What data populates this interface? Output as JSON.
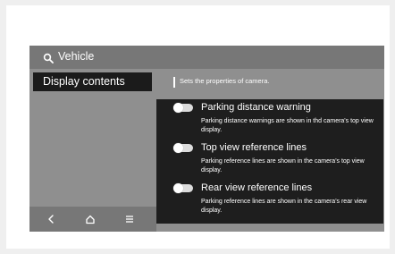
{
  "header": {
    "search_label": "Vehicle",
    "search_icon": "search-icon"
  },
  "sidebar": {
    "items": [
      {
        "label": "Display contents",
        "selected": true
      }
    ]
  },
  "main": {
    "description": "Sets the properties of camera.",
    "options": [
      {
        "title": "Parking distance warning",
        "description": "Parking distance warnings are shown in thd camera's top view display.",
        "enabled": false
      },
      {
        "title": "Top view reference lines",
        "description": "Parking reference lines are shown in the camera's top view display.",
        "enabled": false
      },
      {
        "title": "Rear view reference lines",
        "description": "Parking reference lines are shown in the camera's rear view display.",
        "enabled": false
      }
    ]
  },
  "nav": {
    "icons": [
      "back-icon",
      "home-icon",
      "menu-icon"
    ]
  },
  "colors": {
    "screen_bg": "#8f8f8f",
    "bar_bg": "#777777",
    "panel_bg": "#1e1e1e",
    "selected_bg": "#1b1b1b",
    "text": "#ffffff"
  }
}
